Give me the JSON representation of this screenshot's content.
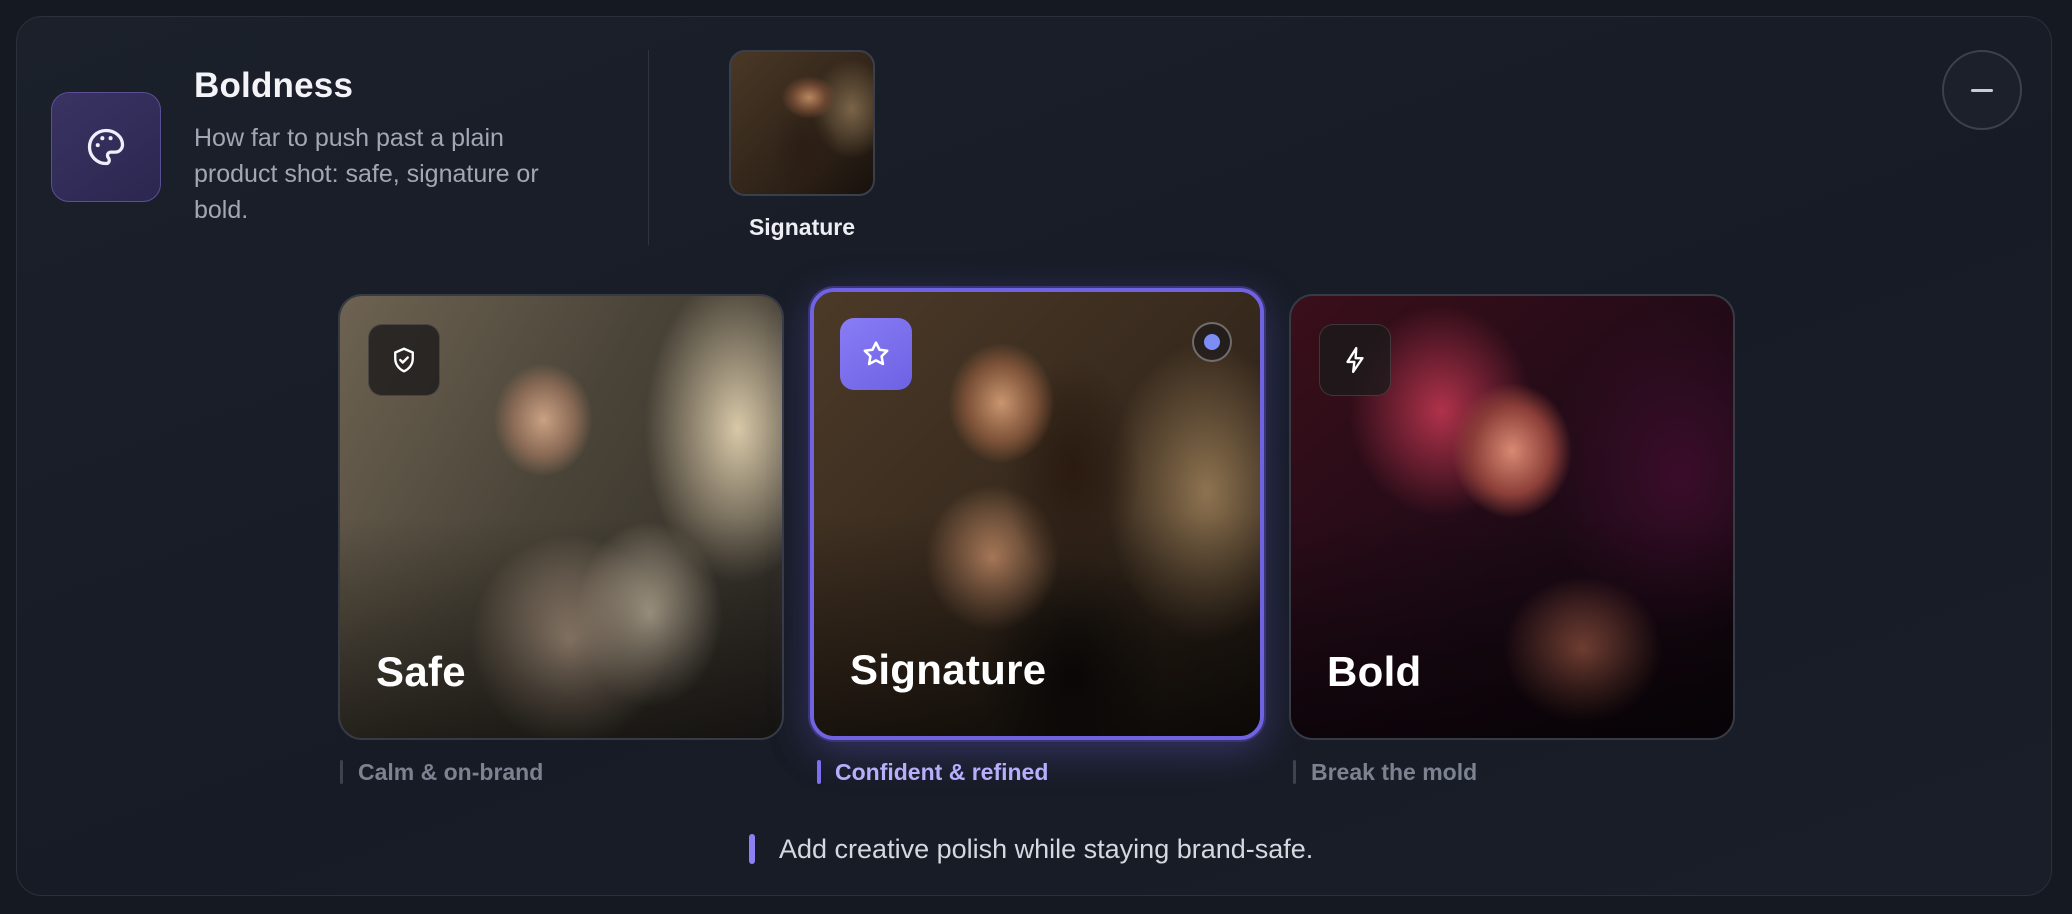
{
  "header": {
    "title": "Boldness",
    "description": "How far to push past a plain product shot: safe, signature or bold.",
    "icon": "palette-icon",
    "accent": "#6f63e0"
  },
  "preview": {
    "label": "Signature"
  },
  "collapse_button": {
    "icon": "minus-icon"
  },
  "options": [
    {
      "id": "safe",
      "label": "Safe",
      "caption": "Calm & on-brand",
      "icon": "shield-check-icon",
      "selected": false
    },
    {
      "id": "signature",
      "label": "Signature",
      "caption": "Confident & refined",
      "icon": "star-icon",
      "selected": true
    },
    {
      "id": "bold",
      "label": "Bold",
      "caption": "Break the mold",
      "icon": "lightning-icon",
      "selected": false
    }
  ],
  "hint": "Add creative polish while staying brand-safe."
}
